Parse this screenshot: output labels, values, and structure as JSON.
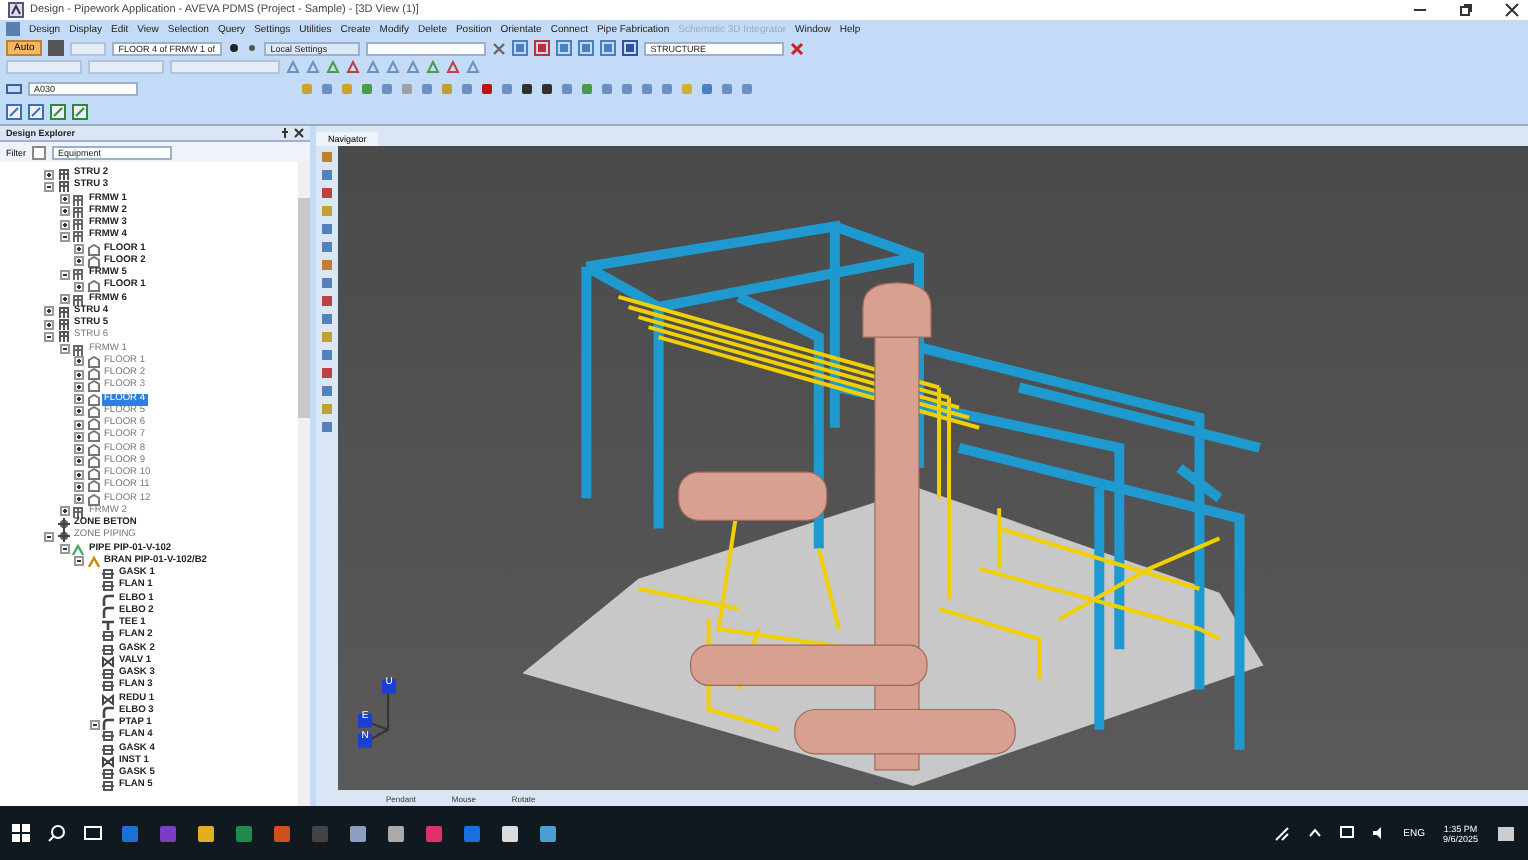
{
  "window": {
    "title": "Design - Pipework Application - AVEVA PDMS (Project - Sample) - [3D View (1)]"
  },
  "menu": [
    {
      "label": "Design",
      "disabled": false
    },
    {
      "label": "Display",
      "disabled": false
    },
    {
      "label": "Edit",
      "disabled": false
    },
    {
      "label": "View",
      "disabled": false
    },
    {
      "label": "Selection",
      "disabled": false
    },
    {
      "label": "Query",
      "disabled": false
    },
    {
      "label": "Settings",
      "disabled": false
    },
    {
      "label": "Utilities",
      "disabled": false
    },
    {
      "label": "Create",
      "disabled": false
    },
    {
      "label": "Modify",
      "disabled": false
    },
    {
      "label": "Delete",
      "disabled": false
    },
    {
      "label": "Position",
      "disabled": false
    },
    {
      "label": "Orientate",
      "disabled": false
    },
    {
      "label": "Connect",
      "disabled": false
    },
    {
      "label": "Pipe Fabrication",
      "disabled": false
    },
    {
      "label": "Schematic 3D Integrator",
      "disabled": true
    },
    {
      "label": "Window",
      "disabled": false
    },
    {
      "label": "Help",
      "disabled": false
    }
  ],
  "toolbar": {
    "mode_button": "Auto",
    "element_combo": "FLOOR 4 of FRMW 1 of",
    "settings_combo": "Local Settings",
    "structure_combo": "STRUCTURE",
    "name_field": "A030"
  },
  "explorer": {
    "title": "Design Explorer",
    "filter_label": "Filter",
    "filter_checked": false,
    "filter_value": "Equipment",
    "tree": [
      {
        "label": "STRU 2",
        "kind": "structure",
        "expanded": false,
        "dimmed": false,
        "selected": false
      },
      {
        "label": "STRU 3",
        "kind": "structure",
        "expanded": true,
        "dimmed": false,
        "selected": false,
        "children": [
          {
            "label": "FRMW 1",
            "kind": "framework",
            "expanded": false,
            "dimmed": false,
            "selected": false
          },
          {
            "label": "FRMW 2",
            "kind": "framework",
            "expanded": false,
            "dimmed": false,
            "selected": false
          },
          {
            "label": "FRMW 3",
            "kind": "framework",
            "expanded": false,
            "dimmed": false,
            "selected": false
          },
          {
            "label": "FRMW 4",
            "kind": "framework",
            "expanded": true,
            "dimmed": false,
            "selected": false,
            "children": [
              {
                "label": "FLOOR 1",
                "kind": "floor",
                "expanded": false,
                "dimmed": false,
                "selected": false
              },
              {
                "label": "FLOOR 2",
                "kind": "floor",
                "expanded": false,
                "dimmed": false,
                "selected": false
              }
            ]
          },
          {
            "label": "FRMW 5",
            "kind": "framework",
            "expanded": true,
            "dimmed": false,
            "selected": false,
            "children": [
              {
                "label": "FLOOR 1",
                "kind": "floor",
                "expanded": false,
                "dimmed": false,
                "selected": false
              }
            ]
          },
          {
            "label": "FRMW 6",
            "kind": "framework",
            "expanded": false,
            "dimmed": false,
            "selected": false
          }
        ]
      },
      {
        "label": "STRU 4",
        "kind": "structure",
        "expanded": false,
        "dimmed": false,
        "selected": false
      },
      {
        "label": "STRU 5",
        "kind": "structure",
        "expanded": false,
        "dimmed": false,
        "selected": false
      },
      {
        "label": "STRU 6",
        "kind": "structure",
        "expanded": true,
        "dimmed": true,
        "selected": false,
        "children": [
          {
            "label": "FRMW 1",
            "kind": "framework",
            "expanded": true,
            "dimmed": true,
            "selected": false,
            "children": [
              {
                "label": "FLOOR 1",
                "kind": "floor",
                "expanded": false,
                "dimmed": true,
                "selected": false
              },
              {
                "label": "FLOOR 2",
                "kind": "floor",
                "expanded": false,
                "dimmed": true,
                "selected": false
              },
              {
                "label": "FLOOR 3",
                "kind": "floor",
                "expanded": false,
                "dimmed": true,
                "selected": false
              },
              {
                "label": "FLOOR 4",
                "kind": "floor",
                "expanded": false,
                "dimmed": true,
                "selected": true
              },
              {
                "label": "FLOOR 5",
                "kind": "floor",
                "expanded": false,
                "dimmed": true,
                "selected": false
              },
              {
                "label": "FLOOR 6",
                "kind": "floor",
                "expanded": false,
                "dimmed": true,
                "selected": false
              },
              {
                "label": "FLOOR 7",
                "kind": "floor",
                "expanded": false,
                "dimmed": true,
                "selected": false
              },
              {
                "label": "FLOOR 8",
                "kind": "floor",
                "expanded": false,
                "dimmed": true,
                "selected": false
              },
              {
                "label": "FLOOR 9",
                "kind": "floor",
                "expanded": false,
                "dimmed": true,
                "selected": false
              },
              {
                "label": "FLOOR 10",
                "kind": "floor",
                "expanded": false,
                "dimmed": true,
                "selected": false
              },
              {
                "label": "FLOOR 11",
                "kind": "floor",
                "expanded": false,
                "dimmed": true,
                "selected": false
              },
              {
                "label": "FLOOR 12",
                "kind": "floor",
                "expanded": false,
                "dimmed": true,
                "selected": false
              }
            ]
          },
          {
            "label": "FRMW 2",
            "kind": "framework",
            "expanded": false,
            "dimmed": true,
            "selected": false
          }
        ]
      },
      {
        "label": "ZONE BETON",
        "kind": "zone",
        "dimmed": false,
        "selected": false
      },
      {
        "label": "ZONE PIPING",
        "kind": "zone",
        "expanded": true,
        "dimmed": true,
        "selected": false,
        "children": [
          {
            "label": "PIPE PIP-01-V-102",
            "kind": "pipe",
            "expanded": true,
            "dimmed": false,
            "selected": false,
            "children": [
              {
                "label": "BRAN PIP-01-V-102/B2",
                "kind": "branch",
                "expanded": true,
                "dimmed": false,
                "selected": false,
                "children": [
                  {
                    "label": "GASK 1",
                    "kind": "fitting",
                    "dimmed": false,
                    "selected": false
                  },
                  {
                    "label": "FLAN 1",
                    "kind": "fitting",
                    "dimmed": false,
                    "selected": false
                  },
                  {
                    "label": "ELBO 1",
                    "kind": "elbow",
                    "dimmed": false,
                    "selected": false
                  },
                  {
                    "label": "ELBO 2",
                    "kind": "elbow",
                    "dimmed": false,
                    "selected": false
                  },
                  {
                    "label": "TEE 1",
                    "kind": "tee",
                    "dimmed": false,
                    "selected": false
                  },
                  {
                    "label": "FLAN 2",
                    "kind": "fitting",
                    "dimmed": false,
                    "selected": false
                  },
                  {
                    "label": "GASK 2",
                    "kind": "fitting",
                    "dimmed": false,
                    "selected": false
                  },
                  {
                    "label": "VALV 1",
                    "kind": "valve",
                    "dimmed": false,
                    "selected": false
                  },
                  {
                    "label": "GASK 3",
                    "kind": "fitting",
                    "dimmed": false,
                    "selected": false
                  },
                  {
                    "label": "FLAN 3",
                    "kind": "fitting",
                    "dimmed": false,
                    "selected": false
                  },
                  {
                    "label": "REDU 1",
                    "kind": "valve",
                    "dimmed": false,
                    "selected": false
                  },
                  {
                    "label": "ELBO 3",
                    "kind": "elbow",
                    "dimmed": false,
                    "selected": false
                  },
                  {
                    "label": "PTAP 1",
                    "kind": "elbow",
                    "expanded": true,
                    "dimmed": false,
                    "selected": false
                  },
                  {
                    "label": "FLAN 4",
                    "kind": "fitting",
                    "dimmed": false,
                    "selected": false
                  },
                  {
                    "label": "GASK 4",
                    "kind": "fitting",
                    "dimmed": false,
                    "selected": false
                  },
                  {
                    "label": "INST 1",
                    "kind": "valve",
                    "dimmed": false,
                    "selected": false
                  },
                  {
                    "label": "GASK 5",
                    "kind": "fitting",
                    "dimmed": false,
                    "selected": false
                  },
                  {
                    "label": "FLAN 5",
                    "kind": "fitting",
                    "dimmed": false,
                    "selected": false
                  }
                ]
              }
            ]
          }
        ]
      }
    ]
  },
  "view": {
    "tab": "Navigator",
    "axes": [
      "E",
      "U",
      "N"
    ]
  },
  "status_bar": [
    "Pendant",
    "Mouse",
    "Rotate"
  ],
  "taskbar": {
    "language": "ENG",
    "time": "1:35 PM",
    "date": "9/6/2025"
  }
}
